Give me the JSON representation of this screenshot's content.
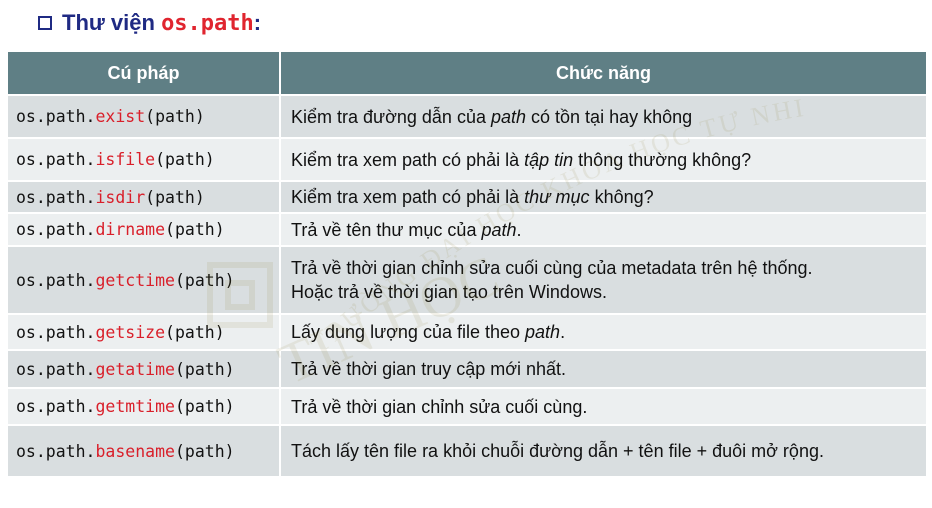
{
  "title": {
    "prefix": "Thư viện ",
    "module": "os.path",
    "suffix": ":"
  },
  "table": {
    "headers": [
      "Cú pháp",
      "Chức năng"
    ],
    "rows": [
      {
        "pre": "os.path.",
        "fn": "exist",
        "post": "(path)",
        "d1": "Kiểm tra đường dẫn của ",
        "d2": "path",
        "d3": " có tồn tại hay không",
        "d4": ""
      },
      {
        "pre": "os.path.",
        "fn": "isfile",
        "post": "(path)",
        "d1": "Kiểm tra xem path có phải là ",
        "d2": "tập tin",
        "d3": " thông thường không?",
        "d4": ""
      },
      {
        "pre": "os.path.",
        "fn": "isdir",
        "post": "(path)",
        "d1": "Kiểm tra xem path có phải là ",
        "d2": "thư mục",
        "d3": " không?",
        "d4": ""
      },
      {
        "pre": "os.path.",
        "fn": "dirname",
        "post": "(path)",
        "d1": "Trả về tên thư mục của ",
        "d2": "path",
        "d3": ".",
        "d4": ""
      },
      {
        "pre": "os.path.",
        "fn": "getctime",
        "post": "(path)",
        "d1": "Trả về thời gian chỉnh sửa cuối cùng của metadata trên hệ thống.",
        "d2": "",
        "d3": "",
        "d4": "Hoặc trả về thời gian tạo trên Windows."
      },
      {
        "pre": "os.path.",
        "fn": "getsize",
        "post": "(path)",
        "d1": "Lấy dung lượng của file theo ",
        "d2": "path",
        "d3": ".",
        "d4": ""
      },
      {
        "pre": "os.path.",
        "fn": "getatime",
        "post": "(path)",
        "d1": "Trả về thời gian truy cập mới nhất.",
        "d2": "",
        "d3": "",
        "d4": ""
      },
      {
        "pre": "os.path.",
        "fn": "getmtime",
        "post": "(path)",
        "d1": "Trả về thời gian chỉnh sửa cuối cùng.",
        "d2": "",
        "d3": "",
        "d4": ""
      },
      {
        "pre": "os.path.",
        "fn": "basename",
        "post": "(path)",
        "d1": "Tách lấy tên file ra khỏi chuỗi đường dẫn + tên file + đuôi mở rộng.",
        "d2": "",
        "d3": "",
        "d4": ""
      }
    ]
  },
  "watermark": {
    "arc": "TRƯỜNG ĐẠI HỌC KHOA HỌC TỰ NHIÊN",
    "main": "KHOA CÔNG NGHỆ THÔNG TIN",
    "tin": "TIN HỌC",
    "color": "#8a7a2a"
  },
  "colors": {
    "header": "#5f7f85",
    "row_dark": "#d9dee0",
    "row_light": "#eceff0",
    "accent_red": "#d91f2a",
    "title_blue": "#1f2a83"
  }
}
